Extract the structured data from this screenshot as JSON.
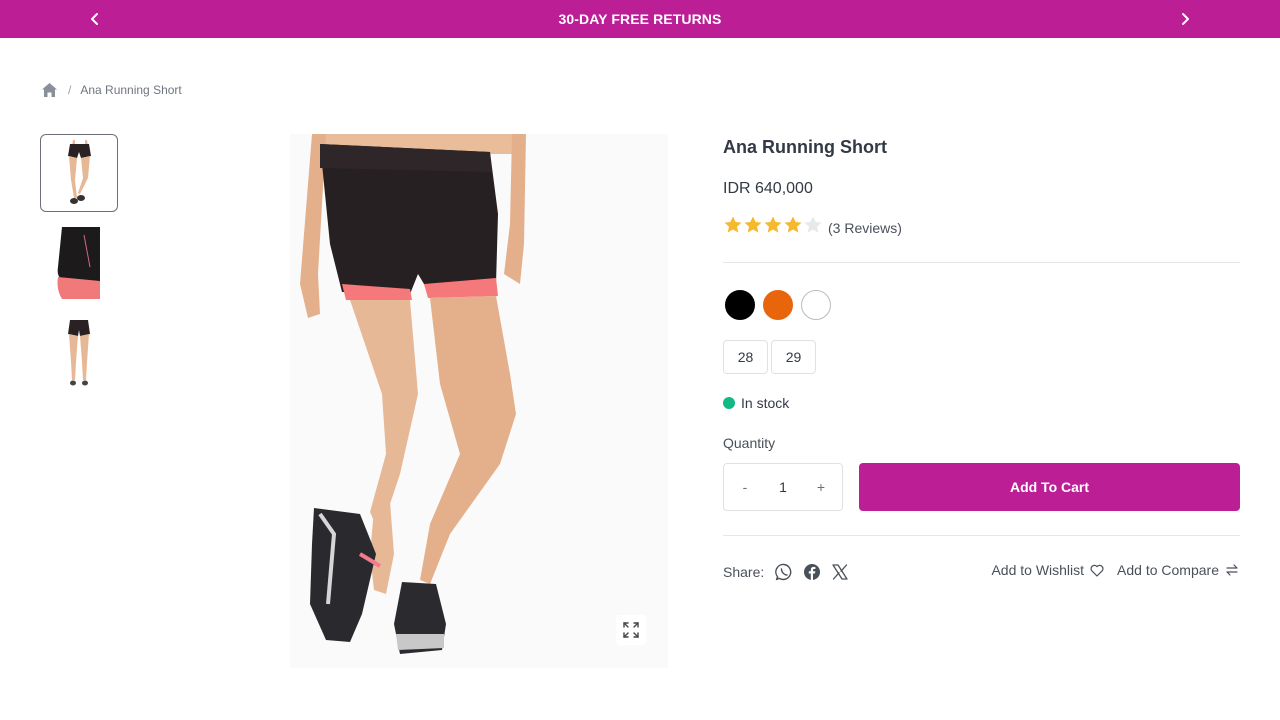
{
  "promo": {
    "text": "30-DAY FREE RETURNS"
  },
  "breadcrumb": {
    "current": "Ana Running Short"
  },
  "product": {
    "title": "Ana Running Short",
    "price": "IDR 640,000",
    "rating": 4,
    "rating_max": 5,
    "reviews_text": "(3 Reviews)",
    "colors": [
      "#000000",
      "#e8650c",
      "#ffffff"
    ],
    "sizes": [
      "28",
      "29"
    ],
    "stock_text": "In stock",
    "quantity_label": "Quantity",
    "quantity_value": "1",
    "qty_minus": "-",
    "qty_plus": "+",
    "add_to_cart": "Add To Cart"
  },
  "share": {
    "label": "Share:",
    "icons": [
      "whatsapp-icon",
      "facebook-icon",
      "x-icon"
    ]
  },
  "actions": {
    "wishlist": "Add to Wishlist",
    "compare": "Add to Compare"
  },
  "theme": {
    "accent": "#bc1e96",
    "star": "#f5b82e",
    "stock": "#12b886"
  }
}
